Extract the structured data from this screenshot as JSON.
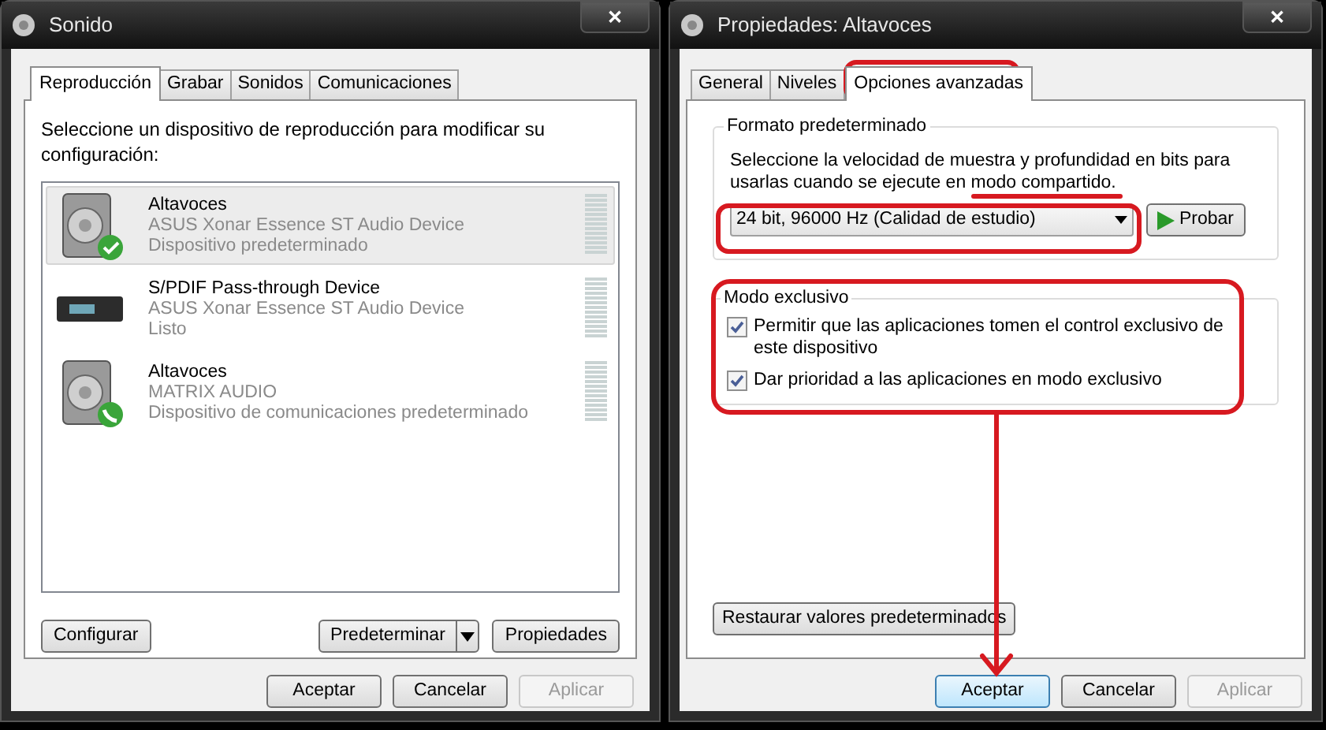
{
  "sound_window": {
    "title": "Sonido",
    "close": "✕",
    "tabs": [
      {
        "label": "Reproducción",
        "selected": true
      },
      {
        "label": "Grabar",
        "selected": false
      },
      {
        "label": "Sonidos",
        "selected": false
      },
      {
        "label": "Comunicaciones",
        "selected": false
      }
    ],
    "instruction": "Seleccione un dispositivo de reproducción para modificar su configuración:",
    "devices": [
      {
        "name": "Altavoces",
        "driver": "ASUS Xonar Essence ST Audio Device",
        "status": "Dispositivo predeterminado",
        "kind": "speaker",
        "default_device": true,
        "communications_device": false,
        "selected": true
      },
      {
        "name": "S/PDIF Pass-through Device",
        "driver": "ASUS Xonar Essence ST Audio Device",
        "status": "Listo",
        "kind": "receiver",
        "default_device": false,
        "communications_device": false,
        "selected": false
      },
      {
        "name": "Altavoces",
        "driver": "MATRIX AUDIO",
        "status": "Dispositivo de comunicaciones predeterminado",
        "kind": "speaker",
        "default_device": false,
        "communications_device": true,
        "selected": false
      }
    ],
    "actions": [
      {
        "label": "Configurar",
        "kind": "button"
      },
      {
        "label": "Predeterminar",
        "kind": "split"
      },
      {
        "label": "Propiedades",
        "kind": "button"
      }
    ],
    "buttons": [
      {
        "label": "Aceptar",
        "disabled": false,
        "focused": false
      },
      {
        "label": "Cancelar",
        "disabled": false,
        "focused": false
      },
      {
        "label": "Aplicar",
        "disabled": true,
        "focused": false
      }
    ]
  },
  "properties_window": {
    "title": "Propiedades: Altavoces",
    "close": "✕",
    "tabs": [
      {
        "label": "General",
        "selected": false
      },
      {
        "label": "Niveles",
        "selected": false
      },
      {
        "label": "Opciones avanzadas",
        "selected": true
      }
    ],
    "format_group": {
      "title": "Formato predeterminado",
      "description": "Seleccione la velocidad de muestra y profundidad en bits para usarlas cuando se ejecute en modo compartido.",
      "format": "24 bit, 96000 Hz (Calidad de estudio)",
      "test_button": "Probar"
    },
    "exclusive_group": {
      "title": "Modo exclusivo",
      "options": [
        {
          "label": "Permitir que las aplicaciones tomen el control exclusivo de este dispositivo",
          "checked": true
        },
        {
          "label": "Dar prioridad a las aplicaciones en modo exclusivo",
          "checked": true
        }
      ]
    },
    "restore_button": "Restaurar valores predeterminados",
    "buttons": [
      {
        "label": "Aceptar",
        "disabled": false,
        "focused": true
      },
      {
        "label": "Cancelar",
        "disabled": false,
        "focused": false
      },
      {
        "label": "Aplicar",
        "disabled": true,
        "focused": false
      }
    ]
  }
}
